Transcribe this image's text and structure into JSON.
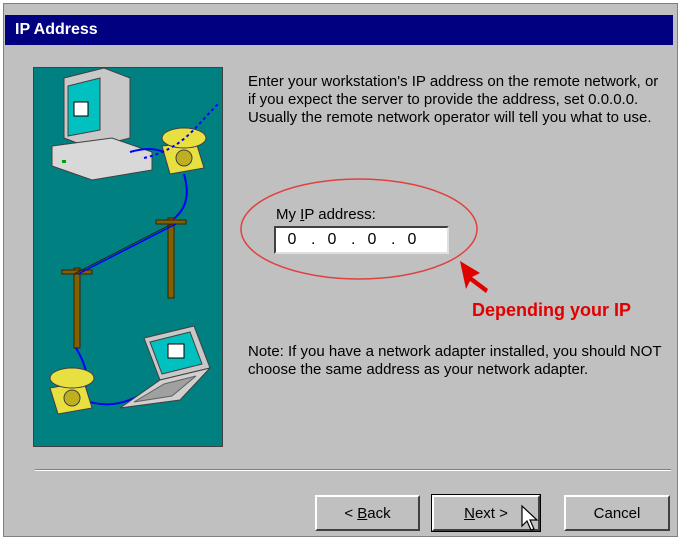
{
  "window": {
    "title": "IP Address"
  },
  "intro_text": "Enter your workstation's IP address on the remote network, or if you expect the server to provide the address, set 0.0.0.0.  Usually the remote network operator will tell you what to use.",
  "ip": {
    "label_pre": "My ",
    "label_accel": "I",
    "label_post": "P address:",
    "octets": [
      "0",
      "0",
      "0",
      "0"
    ],
    "separator": "."
  },
  "annotation": {
    "text": "Depending your IP",
    "color": "#e00000"
  },
  "note_text": "Note: If you have a network adapter installed, you should NOT choose the same address as your network adapter.",
  "buttons": {
    "back_prefix": "< ",
    "back_accel": "B",
    "back_rest": "ack",
    "next_accel": "N",
    "next_rest": "ext >",
    "cancel": "Cancel"
  },
  "colors": {
    "titlebar": "#000080",
    "illustration_bg": "#008080",
    "dialog_bg": "#c0c0c0"
  }
}
